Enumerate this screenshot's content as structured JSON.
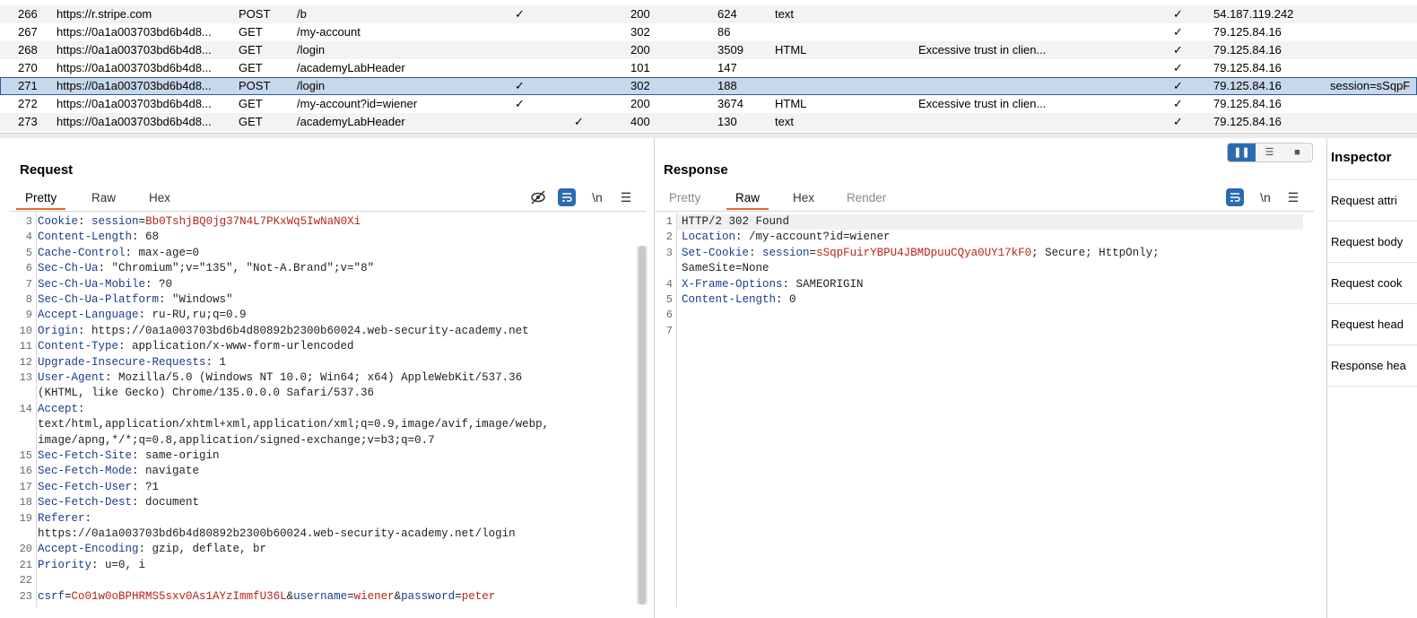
{
  "history": {
    "rows": [
      {
        "num": "266",
        "host": "https://r.stripe.com",
        "method": "POST",
        "url": "/b",
        "param1": "✓",
        "param2": "",
        "status": "200",
        "length": "624",
        "mime": "text",
        "title": "",
        "tls": "✓",
        "ip": "54.187.119.242",
        "cookies": "",
        "alt": true,
        "selected": false
      },
      {
        "num": "267",
        "host": "https://0a1a003703bd6b4d8...",
        "method": "GET",
        "url": "/my-account",
        "param1": "",
        "param2": "",
        "status": "302",
        "length": "86",
        "mime": "",
        "title": "",
        "tls": "✓",
        "ip": "79.125.84.16",
        "cookies": "",
        "alt": false,
        "selected": false
      },
      {
        "num": "268",
        "host": "https://0a1a003703bd6b4d8...",
        "method": "GET",
        "url": "/login",
        "param1": "",
        "param2": "",
        "status": "200",
        "length": "3509",
        "mime": "HTML",
        "title": "Excessive trust in clien...",
        "tls": "✓",
        "ip": "79.125.84.16",
        "cookies": "",
        "alt": true,
        "selected": false
      },
      {
        "num": "270",
        "host": "https://0a1a003703bd6b4d8...",
        "method": "GET",
        "url": "/academyLabHeader",
        "param1": "",
        "param2": "",
        "status": "101",
        "length": "147",
        "mime": "",
        "title": "",
        "tls": "✓",
        "ip": "79.125.84.16",
        "cookies": "",
        "alt": false,
        "selected": false
      },
      {
        "num": "271",
        "host": "https://0a1a003703bd6b4d8...",
        "method": "POST",
        "url": "/login",
        "param1": "✓",
        "param2": "",
        "status": "302",
        "length": "188",
        "mime": "",
        "title": "",
        "tls": "✓",
        "ip": "79.125.84.16",
        "cookies": "session=sSqpF",
        "alt": false,
        "selected": true
      },
      {
        "num": "272",
        "host": "https://0a1a003703bd6b4d8...",
        "method": "GET",
        "url": "/my-account?id=wiener",
        "param1": "✓",
        "param2": "",
        "status": "200",
        "length": "3674",
        "mime": "HTML",
        "title": "Excessive trust in clien...",
        "tls": "✓",
        "ip": "79.125.84.16",
        "cookies": "",
        "alt": false,
        "selected": false
      },
      {
        "num": "273",
        "host": "https://0a1a003703bd6b4d8...",
        "method": "GET",
        "url": "/academyLabHeader",
        "param1": "",
        "param2": "✓",
        "status": "400",
        "length": "130",
        "mime": "text",
        "title": "",
        "tls": "✓",
        "ip": "79.125.84.16",
        "cookies": "",
        "alt": true,
        "selected": false
      }
    ]
  },
  "request": {
    "title": "Request",
    "tabs": [
      "Pretty",
      "Raw",
      "Hex"
    ],
    "active_tab": "Pretty",
    "newline_toggle": "\\n",
    "lines": [
      {
        "num": "3",
        "parts": [
          {
            "t": "Cookie",
            "c": "k"
          },
          {
            "t": ": "
          },
          {
            "t": "session",
            "c": "k"
          },
          {
            "t": "="
          },
          {
            "t": "Bb0TshjBQ0jg37N4L7PKxWq5IwNaN0Xi",
            "c": "v"
          }
        ]
      },
      {
        "num": "4",
        "parts": [
          {
            "t": "Content-Length",
            "c": "k"
          },
          {
            "t": ": 68"
          }
        ]
      },
      {
        "num": "5",
        "parts": [
          {
            "t": "Cache-Control",
            "c": "k"
          },
          {
            "t": ": max-age=0"
          }
        ]
      },
      {
        "num": "6",
        "parts": [
          {
            "t": "Sec-Ch-Ua",
            "c": "k"
          },
          {
            "t": ": \"Chromium\";v=\"135\", \"Not-A.Brand\";v=\"8\""
          }
        ]
      },
      {
        "num": "7",
        "parts": [
          {
            "t": "Sec-Ch-Ua-Mobile",
            "c": "k"
          },
          {
            "t": ": ?0"
          }
        ]
      },
      {
        "num": "8",
        "parts": [
          {
            "t": "Sec-Ch-Ua-Platform",
            "c": "k"
          },
          {
            "t": ": \"Windows\""
          }
        ]
      },
      {
        "num": "9",
        "parts": [
          {
            "t": "Accept-Language",
            "c": "k"
          },
          {
            "t": ": ru-RU,ru;q=0.9"
          }
        ]
      },
      {
        "num": "10",
        "parts": [
          {
            "t": "Origin",
            "c": "k"
          },
          {
            "t": ": https://0a1a003703bd6b4d80892b2300b60024.web-security-academy.net"
          }
        ]
      },
      {
        "num": "11",
        "parts": [
          {
            "t": "Content-Type",
            "c": "k"
          },
          {
            "t": ": application/x-www-form-urlencoded"
          }
        ]
      },
      {
        "num": "12",
        "parts": [
          {
            "t": "Upgrade-Insecure-Requests",
            "c": "k"
          },
          {
            "t": ": 1"
          }
        ]
      },
      {
        "num": "13",
        "parts": [
          {
            "t": "User-Agent",
            "c": "k"
          },
          {
            "t": ": Mozilla/5.0 (Windows NT 10.0; Win64; x64) AppleWebKit/537.36"
          }
        ]
      },
      {
        "num": "",
        "parts": [
          {
            "t": "(KHTML, like Gecko) Chrome/135.0.0.0 Safari/537.36"
          }
        ]
      },
      {
        "num": "14",
        "parts": [
          {
            "t": "Accept",
            "c": "k"
          },
          {
            "t": ":"
          }
        ]
      },
      {
        "num": "",
        "parts": [
          {
            "t": "text/html,application/xhtml+xml,application/xml;q=0.9,image/avif,image/webp,"
          }
        ]
      },
      {
        "num": "",
        "parts": [
          {
            "t": "image/apng,*/*;q=0.8,application/signed-exchange;v=b3;q=0.7"
          }
        ]
      },
      {
        "num": "15",
        "parts": [
          {
            "t": "Sec-Fetch-Site",
            "c": "k"
          },
          {
            "t": ": same-origin"
          }
        ]
      },
      {
        "num": "16",
        "parts": [
          {
            "t": "Sec-Fetch-Mode",
            "c": "k"
          },
          {
            "t": ": navigate"
          }
        ]
      },
      {
        "num": "17",
        "parts": [
          {
            "t": "Sec-Fetch-User",
            "c": "k"
          },
          {
            "t": ": ?1"
          }
        ]
      },
      {
        "num": "18",
        "parts": [
          {
            "t": "Sec-Fetch-Dest",
            "c": "k"
          },
          {
            "t": ": document"
          }
        ]
      },
      {
        "num": "19",
        "parts": [
          {
            "t": "Referer",
            "c": "k"
          },
          {
            "t": ":"
          }
        ]
      },
      {
        "num": "",
        "parts": [
          {
            "t": "https://0a1a003703bd6b4d80892b2300b60024.web-security-academy.net/login"
          }
        ]
      },
      {
        "num": "20",
        "parts": [
          {
            "t": "Accept-Encoding",
            "c": "k"
          },
          {
            "t": ": gzip, deflate, br"
          }
        ]
      },
      {
        "num": "21",
        "parts": [
          {
            "t": "Priority",
            "c": "k"
          },
          {
            "t": ": u=0, i"
          }
        ]
      },
      {
        "num": "22",
        "parts": []
      },
      {
        "num": "23",
        "parts": [
          {
            "t": "csrf",
            "c": "k"
          },
          {
            "t": "="
          },
          {
            "t": "Co01w0oBPHRMS5sxv0As1AYzImmfU36L",
            "c": "v"
          },
          {
            "t": "&"
          },
          {
            "t": "username",
            "c": "k"
          },
          {
            "t": "="
          },
          {
            "t": "wiener",
            "c": "v"
          },
          {
            "t": "&"
          },
          {
            "t": "password",
            "c": "k"
          },
          {
            "t": "="
          },
          {
            "t": "peter",
            "c": "v"
          }
        ]
      }
    ]
  },
  "response": {
    "title": "Response",
    "tabs": [
      "Pretty",
      "Raw",
      "Hex",
      "Render"
    ],
    "active_tab": "Raw",
    "newline_toggle": "\\n",
    "lines": [
      {
        "num": "1",
        "parts": [
          {
            "t": "HTTP/2 302 Found"
          }
        ]
      },
      {
        "num": "2",
        "parts": [
          {
            "t": "Location",
            "c": "k"
          },
          {
            "t": ": /my-account?id=wiener"
          }
        ]
      },
      {
        "num": "3",
        "parts": [
          {
            "t": "Set-Cookie",
            "c": "k"
          },
          {
            "t": ": "
          },
          {
            "t": "session",
            "c": "k"
          },
          {
            "t": "="
          },
          {
            "t": "sSqpFuirYBPU4JBMDpuuCQya0UY17kF0",
            "c": "v"
          },
          {
            "t": "; Secure; HttpOnly;"
          }
        ]
      },
      {
        "num": "",
        "parts": [
          {
            "t": "SameSite=None"
          }
        ]
      },
      {
        "num": "4",
        "parts": [
          {
            "t": "X-Frame-Options",
            "c": "k"
          },
          {
            "t": ": SAMEORIGIN"
          }
        ]
      },
      {
        "num": "5",
        "parts": [
          {
            "t": "Content-Length",
            "c": "k"
          },
          {
            "t": ": 0"
          }
        ]
      },
      {
        "num": "6",
        "parts": []
      },
      {
        "num": "7",
        "parts": []
      }
    ]
  },
  "inspector": {
    "title": "Inspector",
    "items": [
      "Request attri",
      "Request body",
      "Request cook",
      "Request head",
      "Response hea"
    ]
  },
  "colors": {
    "accent": "#e8652c",
    "selected_row": "#c8d8ec",
    "header_key": "#1a3c8c",
    "value": "#b8241c",
    "button_blue": "#2b6cb0"
  }
}
